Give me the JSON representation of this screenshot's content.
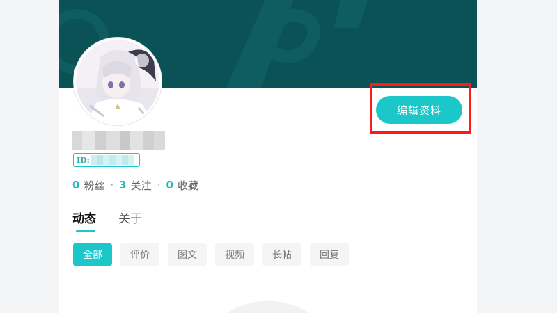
{
  "profile": {
    "edit_label": "编辑资料",
    "id_label": "ID:",
    "nickname_blurred": true
  },
  "stats": {
    "followers_count": "0",
    "followers_label": "粉丝",
    "following_count": "3",
    "following_label": "关注",
    "favorites_count": "0",
    "favorites_label": "收藏",
    "separator": "·"
  },
  "tabs": [
    {
      "label": "动态",
      "active": true
    },
    {
      "label": "关于",
      "active": false
    }
  ],
  "filters": [
    {
      "label": "全部",
      "active": true
    },
    {
      "label": "评价",
      "active": false
    },
    {
      "label": "图文",
      "active": false
    },
    {
      "label": "视频",
      "active": false
    },
    {
      "label": "长帖",
      "active": false
    },
    {
      "label": "回复",
      "active": false
    }
  ],
  "colors": {
    "banner": "#0a5256",
    "accent": "#1cc7c9",
    "highlight_box": "#ff1a1a",
    "page_bg": "#f4f5f7"
  },
  "icons": {
    "avatar": "anime-character-avatar",
    "banner_watermark": "brand-watermark"
  }
}
